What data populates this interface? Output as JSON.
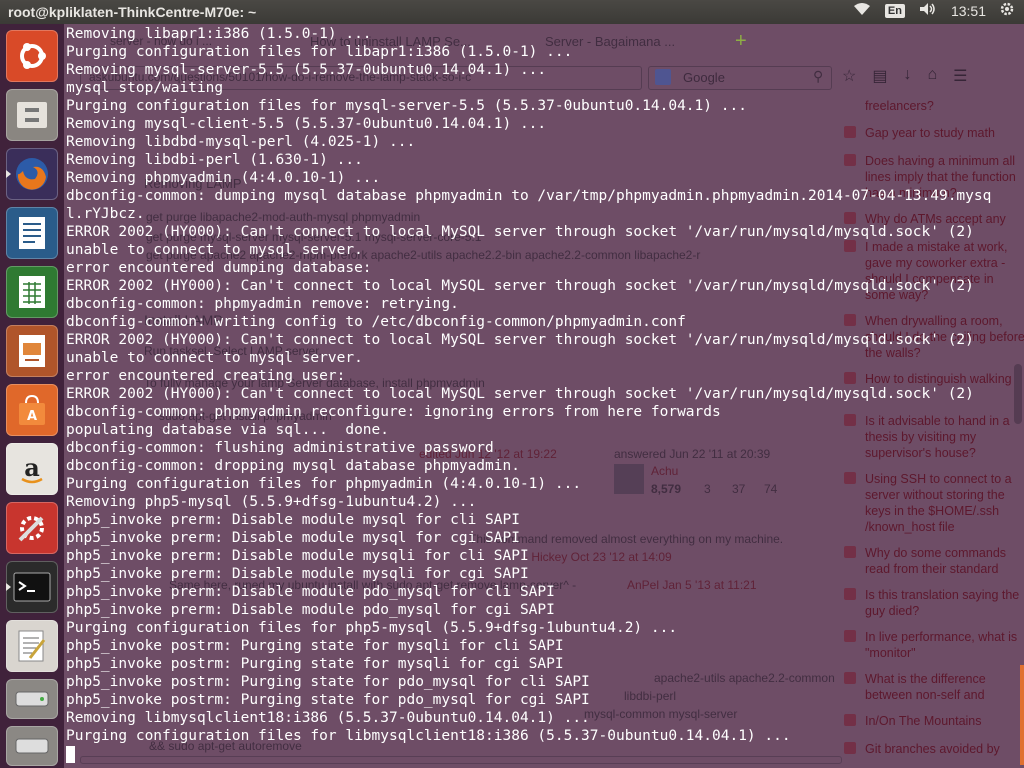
{
  "top_panel": {
    "title": "root@kpliklaten-ThinkCentre-M70e: ~",
    "lang": "En",
    "time": "13:51"
  },
  "launcher": {
    "items": [
      "ubuntu-dash",
      "files",
      "firefox",
      "writer",
      "calc",
      "impress",
      "software-center",
      "amazon",
      "system-settings",
      "terminal",
      "text-editor",
      "disk-drive",
      "disk-drive-2"
    ]
  },
  "browser": {
    "tabs": [
      "server - how do i ...",
      "How to uninstall LAMP Se...",
      "Server - Bagaimana ..."
    ],
    "url": "askubuntu.com/questions/50101/how-do-i-remove-the-lamp-stack-so-i-c",
    "search_placeholder": "Google",
    "content": [
      "Removing LAMP",
      "get purge libapache2-mod-auth-mysql phpmyadmin",
      "get purge mysql-server mysql-server-5.1 mysql-server-core-5.1",
      "get purge apache2 apache2-mpm-prefork apache2-utils apache2.2-bin apache2.2-common libapache2-r",
      "Install LAMP",
      "Run tasksel. Select LAMP server.",
      "To fully manage your lamp Server database, install phpmyadmin",
      "sudo apt-get install phpmyadmin",
      "edited Jun 12 '12 at 19:22",
      "answered Jun 22 '11 at 20:39",
      "Achu",
      "8,579",
      "3",
      "37",
      "74",
      "This command removed almost everything on my machine.",
      "- Hickey Oct 23 '12 at 14:09",
      "Same here, runed my ubuntu install with sudo apt-get remove lamp-server^ -",
      "AnPel Jan 5 '13 at 11:21",
      "apache2-utils apache2.2-common",
      "libdbi-perl",
      "mysql-common mysql-server",
      "&& sudo apt-get autoremove"
    ],
    "sidebar": [
      "freelancers?",
      "Gap year to study math",
      "Does having a minimum all lines imply that the function has a minimum?",
      "Why do ATMs accept any",
      "I made a mistake at work, gave my coworker extra - should I compensate in some way?",
      "When drywalling a room, should I do the ceiling before the walls?",
      "How to distinguish walking",
      "Is it advisable to hand in a thesis by visiting my supervisor's house?",
      "Using SSH to connect to a server without storing the keys in the $HOME/.ssh /known_host file",
      "Why do some commands read from their standard",
      "Is this translation saying the guy died?",
      "In live performance, what is \"monitor\"",
      "What is the difference between non-self and emptiness?",
      "In/On The Mountains",
      "Git branches avoided by"
    ]
  },
  "terminal": {
    "lines": [
      "Removing libapr1:i386 (1.5.0-1) ...",
      "Purging configuration files for libapr1:i386 (1.5.0-1) ...",
      "Removing mysql-server-5.5 (5.5.37-0ubuntu0.14.04.1) ...",
      "mysql stop/waiting",
      "Purging configuration files for mysql-server-5.5 (5.5.37-0ubuntu0.14.04.1) ...",
      "Removing mysql-client-5.5 (5.5.37-0ubuntu0.14.04.1) ...",
      "Removing libdbd-mysql-perl (4.025-1) ...",
      "Removing libdbi-perl (1.630-1) ...",
      "Removing phpmyadmin (4:4.0.10-1) ...",
      "dbconfig-common: dumping mysql database phpmyadmin to /var/tmp/phpmyadmin.phpmyadmin.2014-07-04-13.49.mysq",
      "l.rYJbcz.",
      "ERROR 2002 (HY000): Can't connect to local MySQL server through socket '/var/run/mysqld/mysqld.sock' (2)",
      "unable to connect to mysql server.",
      "error encountered dumping database:",
      "ERROR 2002 (HY000): Can't connect to local MySQL server through socket '/var/run/mysqld/mysqld.sock' (2)",
      "dbconfig-common: phpmyadmin remove: retrying.",
      "dbconfig-common: writing config to /etc/dbconfig-common/phpmyadmin.conf",
      "ERROR 2002 (HY000): Can't connect to local MySQL server through socket '/var/run/mysqld/mysqld.sock' (2)",
      "unable to connect to mysql server.",
      "error encountered creating user:",
      "ERROR 2002 (HY000): Can't connect to local MySQL server through socket '/var/run/mysqld/mysqld.sock' (2)",
      "dbconfig-common: phpmyadmin reconfigure: ignoring errors from here forwards",
      "populating database via sql...  done.",
      "dbconfig-common: flushing administrative password",
      "dbconfig-common: dropping mysql database phpmyadmin.",
      "Purging configuration files for phpmyadmin (4:4.0.10-1) ...",
      "Removing php5-mysql (5.5.9+dfsg-1ubuntu4.2) ...",
      "php5_invoke prerm: Disable module mysql for cli SAPI",
      "php5_invoke prerm: Disable module mysql for cgi SAPI",
      "php5_invoke prerm: Disable module mysqli for cli SAPI",
      "php5_invoke prerm: Disable module mysqli for cgi SAPI",
      "php5_invoke prerm: Disable module pdo_mysql for cli SAPI",
      "php5_invoke prerm: Disable module pdo_mysql for cgi SAPI",
      "Purging configuration files for php5-mysql (5.5.9+dfsg-1ubuntu4.2) ...",
      "php5_invoke postrm: Purging state for mysqli for cli SAPI",
      "php5_invoke postrm: Purging state for mysqli for cgi SAPI",
      "php5_invoke postrm: Purging state for pdo_mysql for cli SAPI",
      "php5_invoke postrm: Purging state for pdo_mysql for cgi SAPI",
      "Removing libmysqlclient18:i386 (5.5.37-0ubuntu0.14.04.1) ...",
      "Purging configuration files for libmysqlclient18:i386 (5.5.37-0ubuntu0.14.04.1) ..."
    ]
  }
}
